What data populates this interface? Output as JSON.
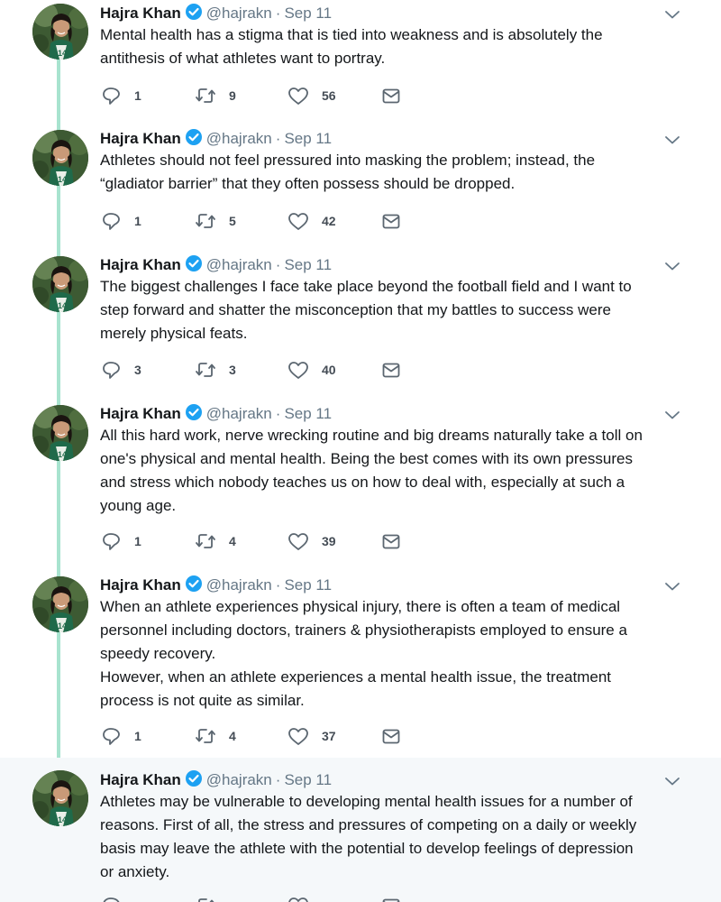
{
  "author": {
    "name": "Hajra Khan",
    "handle": "@hajrakn",
    "separator": "·",
    "date": "Sep 11"
  },
  "icons": {
    "verified": "verified-badge-icon",
    "reply": "reply-icon",
    "retweet": "retweet-icon",
    "like": "heart-icon",
    "dm": "envelope-icon",
    "more": "chevron-down-icon"
  },
  "colors": {
    "thread_line": "#a8e3cf",
    "verified": "#1da1f2",
    "highlight_bg": "#f5f8fa"
  },
  "tweets": [
    {
      "lines": [
        "Mental health has a stigma that is tied into weakness and is absolutely the",
        "antithesis of what athletes want to portray."
      ],
      "replies": "1",
      "retweets": "9",
      "likes": "56"
    },
    {
      "lines": [
        "Athletes should not feel pressured into masking the problem; instead, the",
        "“gladiator barrier” that they often possess should be dropped."
      ],
      "replies": "1",
      "retweets": "5",
      "likes": "42"
    },
    {
      "lines": [
        "The biggest challenges I face take place beyond the football field and I want to",
        "step forward and shatter the misconception that my battles to success were",
        "merely physical feats."
      ],
      "replies": "3",
      "retweets": "3",
      "likes": "40"
    },
    {
      "lines": [
        "All this hard work, nerve wrecking routine and big dreams naturally take a toll on",
        "one's physical and mental health. Being the best comes with its own pressures",
        "and stress which nobody teaches us on how to deal with, especially at such a",
        "young age."
      ],
      "replies": "1",
      "retweets": "4",
      "likes": "39"
    },
    {
      "lines": [
        "When an athlete experiences physical injury, there is often a team of medical",
        "personnel including doctors, trainers & physiotherapists employed to ensure a",
        "speedy recovery.",
        "However, when an athlete experiences a mental health issue, the treatment",
        "process is not quite as similar."
      ],
      "replies": "1",
      "retweets": "4",
      "likes": "37"
    },
    {
      "lines": [
        "Athletes may be vulnerable to developing mental health issues for a number of",
        "reasons. First of all, the stress and pressures of competing on a daily or weekly",
        "basis may leave the athlete with the potential to develop feelings of depression",
        "or anxiety."
      ],
      "replies": "",
      "retweets": "",
      "likes": ""
    }
  ]
}
